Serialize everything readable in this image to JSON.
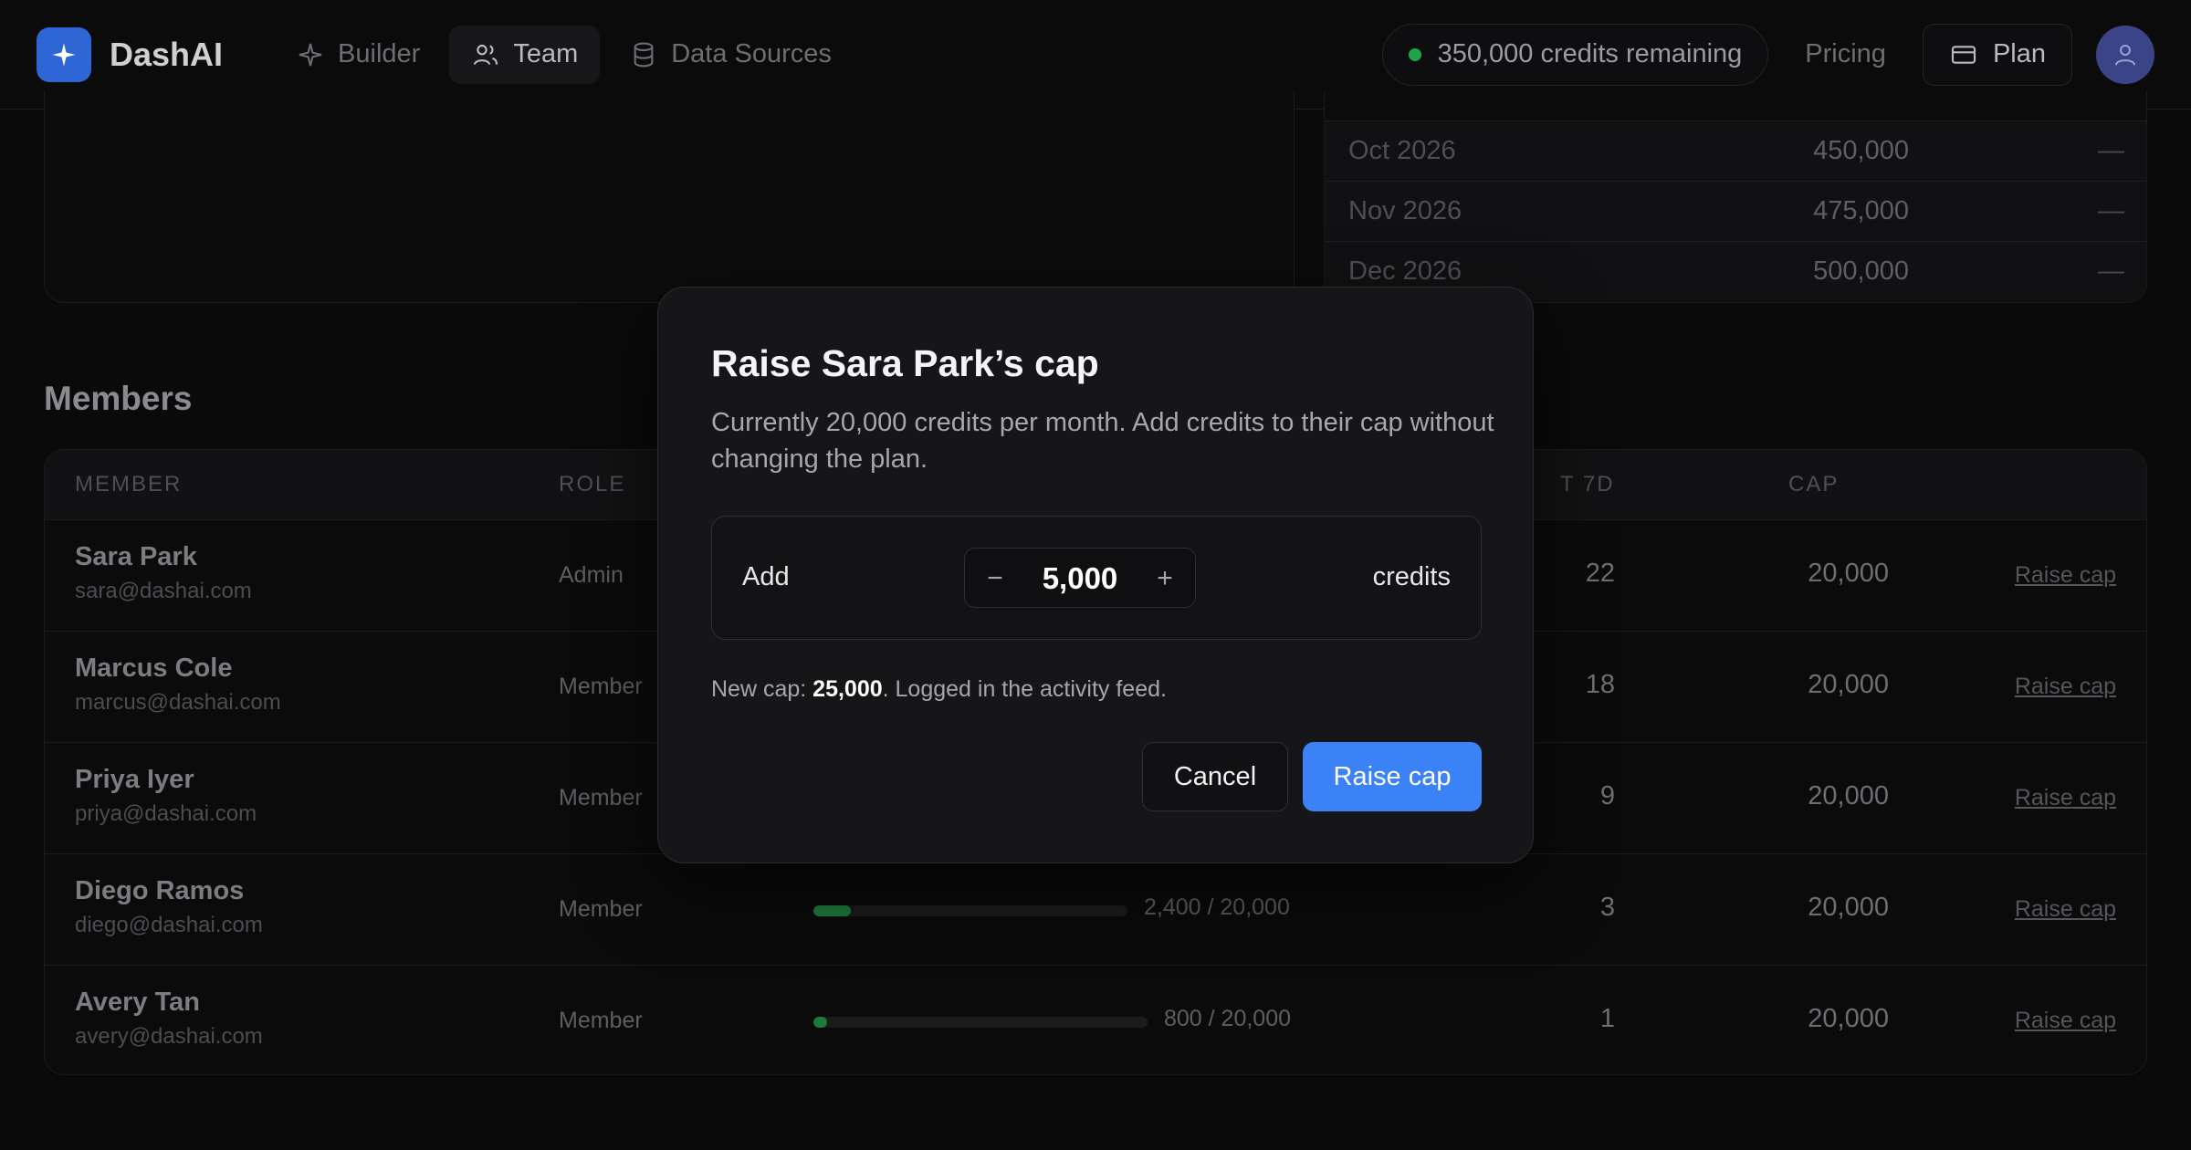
{
  "app": {
    "name": "DashAI"
  },
  "nav": {
    "items": [
      {
        "label": "Builder",
        "icon": "sparkle-icon"
      },
      {
        "label": "Team",
        "icon": "users-icon",
        "active": true
      },
      {
        "label": "Data Sources",
        "icon": "database-icon"
      }
    ],
    "credits": "350,000 credits remaining",
    "pricing": "Pricing",
    "plan": "Plan"
  },
  "forecast": {
    "rows": [
      {
        "month": "Oct 2026",
        "value": "450,000",
        "delta": "—"
      },
      {
        "month": "Nov 2026",
        "value": "475,000",
        "delta": "—"
      },
      {
        "month": "Dec 2026",
        "value": "500,000",
        "delta": "—"
      }
    ]
  },
  "members": {
    "title": "Members",
    "columns": {
      "member": "MEMBER",
      "role": "ROLE",
      "last7": "T 7D",
      "cap": "CAP"
    },
    "rows": [
      {
        "name": "Sara Park",
        "email": "sara@dashai.com",
        "role": "Admin",
        "usage": "",
        "fraction": 0,
        "last7": "22",
        "cap": "20,000",
        "action": "Raise cap"
      },
      {
        "name": "Marcus Cole",
        "email": "marcus@dashai.com",
        "role": "Member",
        "usage": "",
        "fraction": 0,
        "last7": "18",
        "cap": "20,000",
        "action": "Raise cap"
      },
      {
        "name": "Priya Iyer",
        "email": "priya@dashai.com",
        "role": "Member",
        "usage": "",
        "fraction": 0,
        "last7": "9",
        "cap": "20,000",
        "action": "Raise cap"
      },
      {
        "name": "Diego Ramos",
        "email": "diego@dashai.com",
        "role": "Member",
        "usage": "2,400 / 20,000",
        "fraction": 0.12,
        "last7": "3",
        "cap": "20,000",
        "action": "Raise cap"
      },
      {
        "name": "Avery Tan",
        "email": "avery@dashai.com",
        "role": "Member",
        "usage": "800 / 20,000",
        "fraction": 0.04,
        "last7": "1",
        "cap": "20,000",
        "action": "Raise cap"
      }
    ]
  },
  "modal": {
    "title": "Raise Sara Park’s cap",
    "description": "Currently 20,000 credits per month. Add credits to their cap without changing the plan.",
    "add_label": "Add",
    "amount": "5,000",
    "minus": "−",
    "plus": "+",
    "unit": "credits",
    "new_cap_prefix": "New cap: ",
    "new_cap_value": "25,000",
    "new_cap_suffix": ". Logged in the activity feed.",
    "cancel": "Cancel",
    "confirm": "Raise cap"
  },
  "colors": {
    "accent": "#3b82f6",
    "success": "#22a34a",
    "logo": "#2f66d6"
  }
}
